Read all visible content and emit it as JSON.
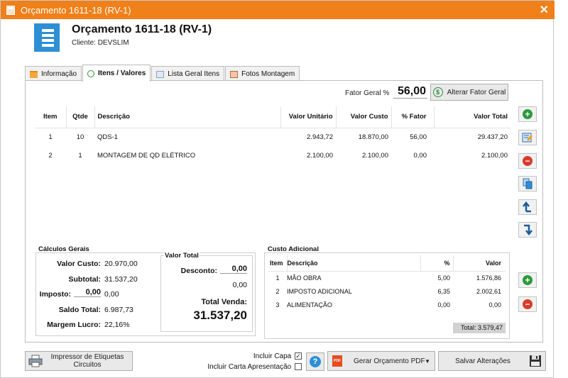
{
  "window": {
    "title": "Orçamento 1611-18 (RV-1)"
  },
  "header": {
    "title": "Orçamento 1611-18 (RV-1)",
    "client_label": "Cliente:",
    "client_name": "DEVSLIM"
  },
  "tabs": [
    {
      "label": "Informação",
      "icon": "folder-icon"
    },
    {
      "label": "Itens / Valores",
      "icon": "money-icon",
      "active": true
    },
    {
      "label": "Lista Geral Itens",
      "icon": "list-icon"
    },
    {
      "label": "Fotos Montagem",
      "icon": "photo-icon"
    }
  ],
  "fator": {
    "label": "Fator Geral %",
    "value": "56,00",
    "button": "Alterar Fator Geral"
  },
  "items_table": {
    "headers": [
      "Item",
      "Qtde",
      "Descrição",
      "Valor Unitário",
      "Valor Custo",
      "% Fator",
      "Valor Total"
    ],
    "rows": [
      [
        "1",
        "10",
        "QDS-1",
        "2.943,72",
        "18.870,00",
        "56,00",
        "29.437,20"
      ],
      [
        "2",
        "1",
        "MONTAGEM DE QD ELÉTRICO",
        "2.100,00",
        "2.100,00",
        "0,00",
        "2.100,00"
      ]
    ]
  },
  "calculos": {
    "title": "Cálculos Gerais",
    "valor_custo_label": "Valor Custo:",
    "valor_custo": "20.970,00",
    "subtotal_label": "Subtotal:",
    "subtotal": "31.537,20",
    "imposto_label": "Imposto:",
    "imposto_pct": "0,00",
    "imposto_val": "0,00",
    "saldo_label": "Saldo Total:",
    "saldo": "6.987,73",
    "margem_label": "Margem Lucro:",
    "margem": "22,16%"
  },
  "valor_total": {
    "title": "Valor Total",
    "desconto_label": "Desconto:",
    "desconto": "0,00",
    "desconto_val": "0,00",
    "total_label": "Total Venda:",
    "total": "31.537,20"
  },
  "custo_adicional": {
    "title": "Custo Adicional",
    "headers": [
      "Item",
      "Descrição",
      "%",
      "Valor"
    ],
    "rows": [
      [
        "1",
        "MÃO OBRA",
        "5,00",
        "1.576,86"
      ],
      [
        "2",
        "IMPOSTO ADICIONAL",
        "6,35",
        "2.002,61"
      ],
      [
        "3",
        "ALIMENTAÇÃO",
        "0,00",
        "0,00"
      ]
    ],
    "total": "Total: 3.579,47"
  },
  "footer": {
    "print_label_line1": "Impressor de Etiquetas",
    "print_label_line2": "Circuitos",
    "incluir_capa": "Incluir Capa",
    "incluir_carta": "Incluir Carta Apresentação",
    "pdf_button": "Gerar Orçamento PDF",
    "save_button": "Salvar Alterações"
  },
  "colors": {
    "titlebar": "#f0801a",
    "accent_blue": "#2e8fd6",
    "add_green": "#2c9a3c",
    "remove_red": "#d93b2b"
  }
}
